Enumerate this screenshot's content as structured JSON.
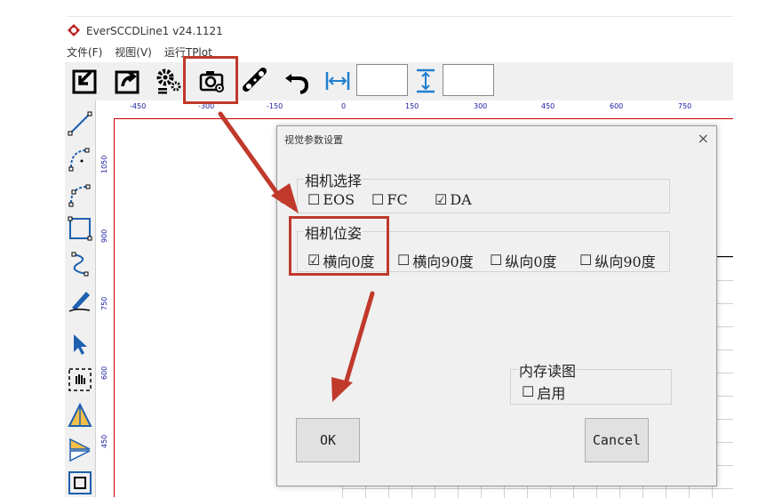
{
  "app": {
    "title": "EverSCCDLine1 v24.1121"
  },
  "menu": [
    "文件(F)",
    "视图(V)",
    "运行TPlot"
  ],
  "toolbar": {
    "icons": [
      "import-icon",
      "export-icon",
      "settings-icon",
      "camera-settings-icon",
      "conveyor-icon",
      "undo-icon",
      "width-icon",
      "height-icon"
    ],
    "width_value": "",
    "height_value": ""
  },
  "left_tools": [
    "line-icon",
    "arc-icon",
    "arc3-icon",
    "rectangle-icon",
    "spline-icon",
    "pen-icon",
    "select-icon",
    "pan-icon",
    "triangle-icon",
    "mirror-icon",
    "frame-icon"
  ],
  "ruler": {
    "h_ticks": [
      "-450",
      "-300",
      "-150",
      "0",
      "150",
      "300",
      "450",
      "600",
      "750"
    ],
    "v_ticks": [
      "1050",
      "900",
      "750",
      "600",
      "450"
    ]
  },
  "dialog": {
    "title": "视觉参数设置",
    "close": "×",
    "camera_group": {
      "label": "相机选择",
      "options": [
        {
          "label": "EOS",
          "checked": false
        },
        {
          "label": "FC",
          "checked": false
        },
        {
          "label": "DA",
          "checked": true
        }
      ]
    },
    "pose_group": {
      "label": "相机位姿",
      "options": [
        {
          "label": "横向0度",
          "checked": true
        },
        {
          "label": "横向90度",
          "checked": false
        },
        {
          "label": "纵向0度",
          "checked": false
        },
        {
          "label": "纵向90度",
          "checked": false
        }
      ]
    },
    "memory_group": {
      "label": "内存读图",
      "options": [
        {
          "label": "启用",
          "checked": false
        }
      ]
    },
    "ok_label": "OK",
    "cancel_label": "Cancel"
  },
  "colors": {
    "annotation": "#c0392b",
    "ruler_text": "#1a1aa0",
    "dialog_bg": "#f0f0f0"
  }
}
